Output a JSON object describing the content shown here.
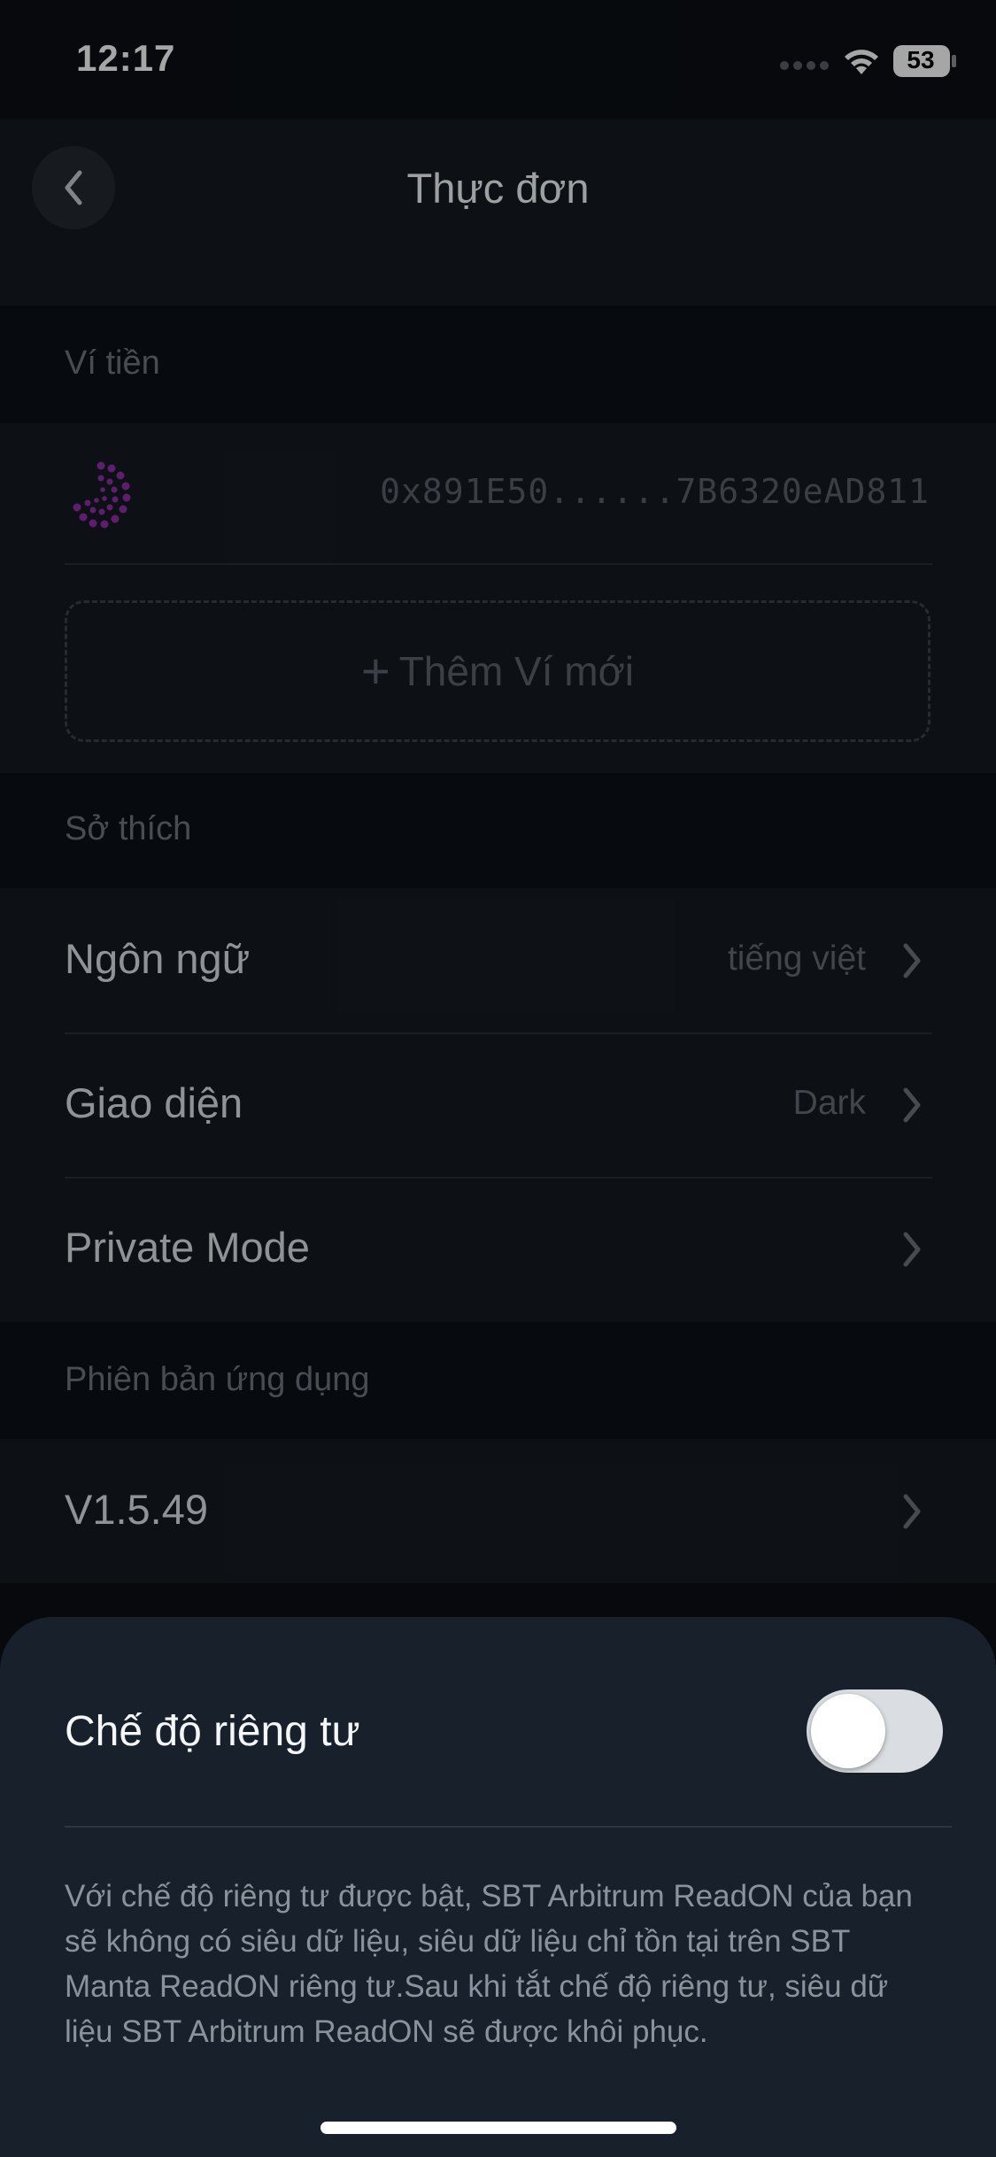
{
  "status_bar": {
    "time": "12:17",
    "battery": "53"
  },
  "nav": {
    "title": "Thực đơn"
  },
  "wallet_section": {
    "header": "Ví tiền",
    "address": "0x891E50......7B6320eAD811",
    "add_wallet_label": "Thêm Ví mới"
  },
  "preferences_section": {
    "header": "Sở thích",
    "items": [
      {
        "label": "Ngôn ngữ",
        "value": "tiếng việt"
      },
      {
        "label": "Giao diện",
        "value": "Dark"
      },
      {
        "label": "Private Mode",
        "value": ""
      }
    ]
  },
  "version_section": {
    "header": "Phiên bản ứng dụng",
    "version": "V1.5.49"
  },
  "private_sheet": {
    "title": "Chế độ riêng tư",
    "toggle_on": false,
    "description": "Với chế độ riêng tư được bật, SBT Arbitrum ReadON của bạn sẽ không có siêu dữ liệu, siêu dữ liệu chỉ tồn tại trên SBT Manta ReadON riêng tư.Sau khi tắt chế độ riêng tư, siêu dữ liệu SBT Arbitrum ReadON sẽ được khôi phục."
  },
  "colors": {
    "background": "#0b0f14",
    "panel": "#151a20",
    "sheet": "#18212b",
    "wallet_logo": "#8e2fa8"
  }
}
